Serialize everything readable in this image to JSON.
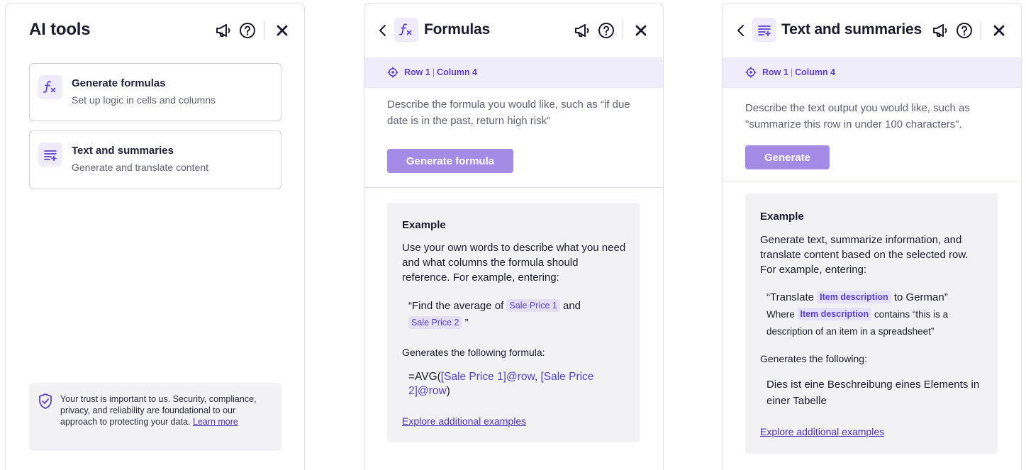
{
  "ai_tools": {
    "title": "AI tools",
    "cards": [
      {
        "title": "Generate formulas",
        "subtitle": "Set up logic in cells and columns",
        "icon": "function-icon"
      },
      {
        "title": "Text and summaries",
        "subtitle": "Generate and translate content",
        "icon": "text-lines-icon"
      }
    ],
    "trust": {
      "text": "Your trust is important to us. Security, compliance, privacy, and reliability are foundational to our approach to protecting your data.",
      "link": "Learn more"
    }
  },
  "formulas": {
    "title": "Formulas",
    "context": {
      "row": "Row 1",
      "column": "Column 4"
    },
    "description": "Describe the formula you would like, such as “if due date is in the past, return high risk”",
    "button": "Generate formula",
    "example": {
      "heading": "Example",
      "paragraph": "Use your own words to describe what you need and what columns the formula should reference. For example, entering:",
      "quote_prefix": "“Find the average of",
      "chip1": "Sale Price 1",
      "quote_and": "and",
      "chip2": "Sale Price 2",
      "quote_suffix": "”",
      "generates": "Generates the following formula:",
      "formula_prefix": "=AVG(",
      "formula_ref1": "[Sale Price 1]@row",
      "formula_comma": ", ",
      "formula_ref2": "[Sale Price 2]@row",
      "formula_suffix": ")",
      "link": "Explore additional examples"
    }
  },
  "text_summaries": {
    "title": "Text and summaries",
    "context": {
      "row": "Row 1",
      "column": "Column 4"
    },
    "description": "Describe the text output you would like, such as \"summarize this row in under 100 characters\".",
    "button": "Generate",
    "example": {
      "heading": "Example",
      "paragraph": "Generate text, summarize information, and translate content based on the selected row. For example, entering:",
      "q1_prefix": "“Translate",
      "chip": "Item description",
      "q1_suffix": "to German”",
      "q2_prefix": "Where",
      "q2_suffix": "contains “this is a description of an item in a spreadsheet”",
      "generates": "Generates the following:",
      "output": "Dies ist eine Beschreibung eines Elements in einer Tabelle",
      "link": "Explore additional examples"
    }
  },
  "colors": {
    "accent": "#5b3fd0",
    "button": "#a48be6",
    "context_bar": "#efedfb",
    "example_bg": "#f2f2f5"
  }
}
